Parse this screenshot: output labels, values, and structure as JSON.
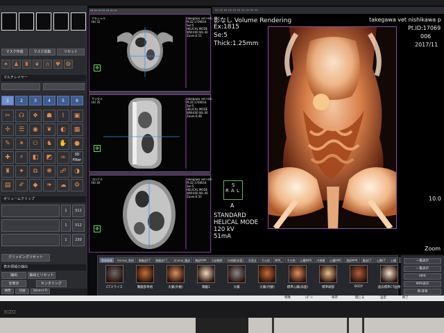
{
  "left_panel": {
    "mask_buttons": [
      "マスク作成",
      "マスク反転",
      "リセット"
    ],
    "multilayer_title": "マルチレイヤー",
    "layer_numbers": [
      "1",
      "2",
      "3",
      "4",
      "5",
      "6"
    ],
    "filter_label": "3D Filter",
    "volume_clip_title": "ボリュームクリップ",
    "clip_rows": [
      {
        "index": "1",
        "value": "512"
      },
      {
        "index": "1",
        "value": "512"
      },
      {
        "index": "1",
        "value": "230"
      }
    ],
    "clipping_reset": "クリッピングリセット",
    "display_section": "表示領域の抽出",
    "extract_label": "抽出",
    "extract_reset": "抽出とリセット",
    "all_display": "全表示",
    "centering": "センタリング",
    "bottom_tools": [
      "検像",
      "切画",
      "Slicer+TI"
    ]
  },
  "mpr_views": [
    {
      "id": "axial",
      "left_info": [
        "アキシャル",
        "HU 32"
      ],
      "right_info": [
        "takegawa vet nishikawa p",
        "Pt.ID:1709014",
        "Ser:5",
        "HELICAL MODE",
        "WW:400 WL:40",
        "Zoom:0.51"
      ]
    },
    {
      "id": "sagittal",
      "left_info": [
        "サジタル",
        "HU 35"
      ],
      "right_info": [
        "takegawa vet nishikawa p",
        "Pt.ID:1709014",
        "Ser:5",
        "HELICAL MODE",
        "WW:400 WL:40",
        "Zoom:0.48"
      ]
    },
    {
      "id": "coronal",
      "left_info": [
        "コロナル",
        "HU 40"
      ],
      "right_info": [
        "takegawa vet nishikawa p",
        "Pt.ID:1709014",
        "Ser:5",
        "HELICAL MODE",
        "WW:400 WL:40",
        "Zoom:0.50"
      ]
    }
  ],
  "vr": {
    "title": "影なし Volume Rendering",
    "clinic": "takegawa vet nishikawa p",
    "ex": "Ex:1815",
    "se": "Se:5",
    "thick": "Thick:1.25mm",
    "pt_id": "Pt.ID:17069",
    "date_a": "2017/11",
    "date_b": "006",
    "orientation": {
      "s": "S",
      "r": "R",
      "a": "A",
      "l": "L",
      "bottom": "A"
    },
    "tech": [
      "STANDARD",
      "HELICAL MODE",
      "120 kV",
      "51mA"
    ],
    "value": "10.0",
    "zoom": "Zoom"
  },
  "strip": {
    "tabs": [
      "登録画像",
      "Animal_骨格",
      "胸腹部CT",
      "胸腹部CT_",
      "Animal_腹部",
      "胸部MPR",
      "内部観察",
      "内視鏡(血管)",
      "気管支",
      "その他",
      "MPR_",
      "その他",
      "心臓MPR",
      "内視鏡",
      "心臓MPR",
      "頭部MPR",
      "腹部CT",
      "心臓CT",
      "心臓",
      "内視鏡",
      "骨盤"
    ],
    "thumbs": [
      "CTスライス",
      "胸腹部骨格",
      "大腸(外観)",
      "胸腹1",
      "大腸",
      "大腸(内観)",
      "標準心臓(表面)",
      "標準頭部",
      "BODY",
      "過去標準CT画像"
    ]
  },
  "right_panel": {
    "buttons": [
      "一覧表示",
      "一覧表示",
      "MPR",
      "MPR表示",
      "骨/非骨",
      "比較"
    ]
  },
  "taskbar": {
    "items": [
      "特殊",
      "ﾚﾎﾟｰﾄ",
      "保存",
      "開じる",
      "設定",
      "終了"
    ]
  },
  "monitor_brand": "EIZO"
}
